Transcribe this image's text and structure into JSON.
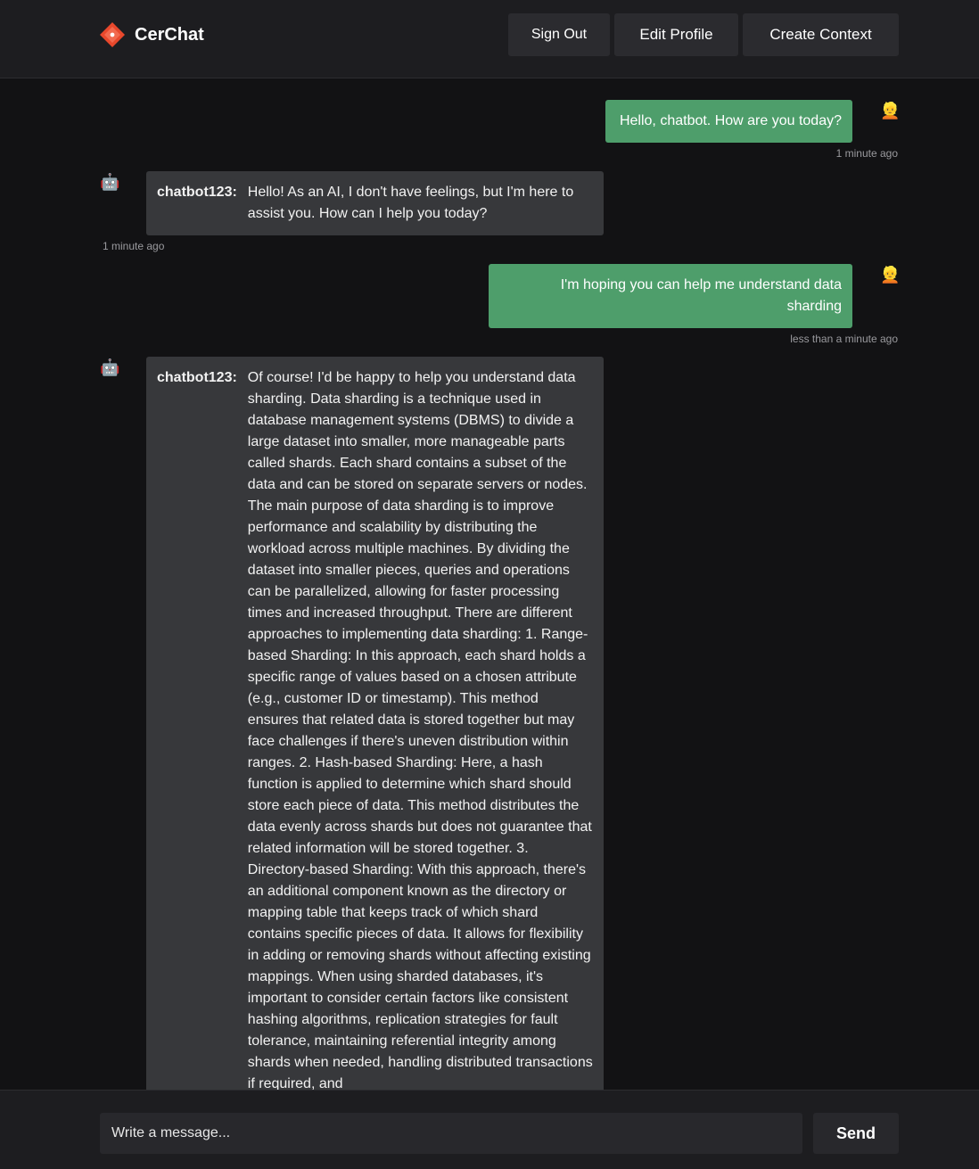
{
  "app": {
    "name": "CerChat",
    "logo_icon": "diamond-logo-icon",
    "accent": "#e8482c"
  },
  "nav": {
    "sign_out": "Sign Out",
    "edit_profile": "Edit Profile",
    "create_context": "Create Context"
  },
  "colors": {
    "user_bubble": "#4e9e6b",
    "bot_bubble": "#37383b",
    "background": "#121214"
  },
  "messages": [
    {
      "sender": "user",
      "avatar": "👱",
      "text": "Hello, chatbot. How are you today?",
      "time": "1 minute ago"
    },
    {
      "sender": "bot",
      "avatar": "🤖",
      "name": "chatbot123:",
      "text": "Hello! As an AI, I don't have feelings, but I'm here to assist you. How can I help you today?",
      "time": "1 minute ago"
    },
    {
      "sender": "user",
      "avatar": "👱",
      "text": "I'm hoping you can help me understand data sharding",
      "time": "less than a minute ago"
    },
    {
      "sender": "bot",
      "avatar": "🤖",
      "name": "chatbot123:",
      "text": "Of course! I'd be happy to help you understand data sharding. Data sharding is a technique used in database management systems (DBMS) to divide a large dataset into smaller, more manageable parts called shards. Each shard contains a subset of the data and can be stored on separate servers or nodes. The main purpose of data sharding is to improve performance and scalability by distributing the workload across multiple machines. By dividing the dataset into smaller pieces, queries and operations can be parallelized, allowing for faster processing times and increased throughput. There are different approaches to implementing data sharding: 1. Range-based Sharding: In this approach, each shard holds a specific range of values based on a chosen attribute (e.g., customer ID or timestamp). This method ensures that related data is stored together but may face challenges if there's uneven distribution within ranges. 2. Hash-based Sharding: Here, a hash function is applied to determine which shard should store each piece of data. This method distributes the data evenly across shards but does not guarantee that related information will be stored together. 3. Directory-based Sharding: With this approach, there's an additional component known as the directory or mapping table that keeps track of which shard contains specific pieces of data. It allows for flexibility in adding or removing shards without affecting existing mappings. When using sharded databases, it's important to consider certain factors like consistent hashing algorithms, replication strategies for fault tolerance, maintaining referential integrity among shards when needed, handling distributed transactions if required, and"
    }
  ],
  "composer": {
    "placeholder": "Write a message...",
    "send_label": "Send"
  }
}
